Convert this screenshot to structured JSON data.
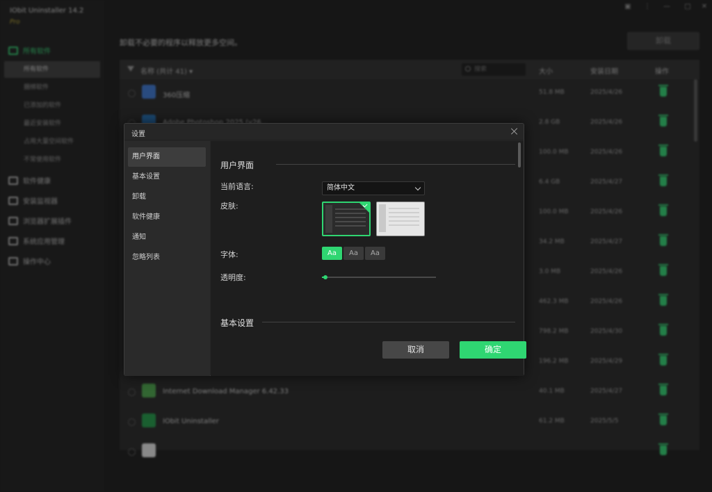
{
  "app": {
    "title": "IObit Uninstaller 14.2",
    "edition": "Pro",
    "window_controls": [
      "▣",
      "⋮",
      "—",
      "□",
      "✕"
    ]
  },
  "sidebar": {
    "groups": [
      {
        "label": "所有软件",
        "icon": "apps-icon"
      },
      {
        "label": "软件健康",
        "icon": "health-icon"
      },
      {
        "label": "安装监视器",
        "icon": "monitor-icon"
      },
      {
        "label": "浏览器扩展插件",
        "icon": "puzzle-icon"
      },
      {
        "label": "系统应用管理",
        "icon": "windows-icon"
      },
      {
        "label": "操作中心",
        "icon": "action-center-icon"
      }
    ],
    "sub_items": [
      "所有软件",
      "捆绑软件",
      "已添加的软件",
      "最近安装软件",
      "占用大量空间软件",
      "不常使用软件"
    ]
  },
  "main": {
    "tip": "卸载不必要的程序以释放更多空间。",
    "uninstall_label": "卸载",
    "table": {
      "name_header": "名称 (共计 41) ▾",
      "search_placeholder": "搜索",
      "size_header": "大小",
      "date_header": "安装日期",
      "action_header": "操作",
      "rows": [
        {
          "name": "360压缩",
          "size": "51.8 MB",
          "date": "2025/4/26",
          "icon_color": "#3a78d6"
        },
        {
          "name": "Adobe Photoshop 2025 (v26...",
          "size": "2.8 GB",
          "date": "2025/4/26",
          "icon_color": "#1f6fb8"
        },
        {
          "name": "",
          "size": "100.0 MB",
          "date": "2025/4/26",
          "icon_color": ""
        },
        {
          "name": "",
          "size": "6.4 GB",
          "date": "2025/4/27",
          "icon_color": ""
        },
        {
          "name": "",
          "size": "100.0 MB",
          "date": "2025/4/26",
          "icon_color": ""
        },
        {
          "name": "",
          "size": "34.2 MB",
          "date": "2025/4/27",
          "icon_color": ""
        },
        {
          "name": "",
          "size": "3.0 MB",
          "date": "2025/4/26",
          "icon_color": ""
        },
        {
          "name": "",
          "size": "462.3 MB",
          "date": "2025/4/26",
          "icon_color": ""
        },
        {
          "name": "",
          "size": "798.2 MB",
          "date": "2025/4/30",
          "icon_color": ""
        },
        {
          "name": "",
          "size": "196.2 MB",
          "date": "2025/4/29",
          "icon_color": ""
        },
        {
          "name": "Internet Download Manager 6.42.33",
          "size": "40.1 MB",
          "date": "2025/4/27",
          "icon_color": "#4aa84a"
        },
        {
          "name": "IObit Uninstaller",
          "size": "61.2 MB",
          "date": "2025/5/5",
          "icon_color": "#1f9b47"
        },
        {
          "name": "",
          "size": "",
          "date": "",
          "icon_color": "#e8e8e8"
        }
      ]
    }
  },
  "dialog": {
    "title": "设置",
    "nav": [
      "用户界面",
      "基本设置",
      "卸载",
      "软件健康",
      "通知",
      "忽略列表"
    ],
    "ui_section_title": "用户界面",
    "language_label": "当前语言:",
    "language_value": "简体中文",
    "skin_label": "皮肤:",
    "skins": [
      {
        "name": "dark",
        "selected": true
      },
      {
        "name": "light",
        "selected": false
      }
    ],
    "font_label": "字体:",
    "font_options": [
      "Aa",
      "Aa",
      "Aa"
    ],
    "font_selected_index": 0,
    "opacity_label": "透明度:",
    "opacity_value": 0.03,
    "basic_section_title": "基本设置",
    "cancel_label": "取消",
    "ok_label": "确定",
    "accent_color": "#2fd672"
  }
}
